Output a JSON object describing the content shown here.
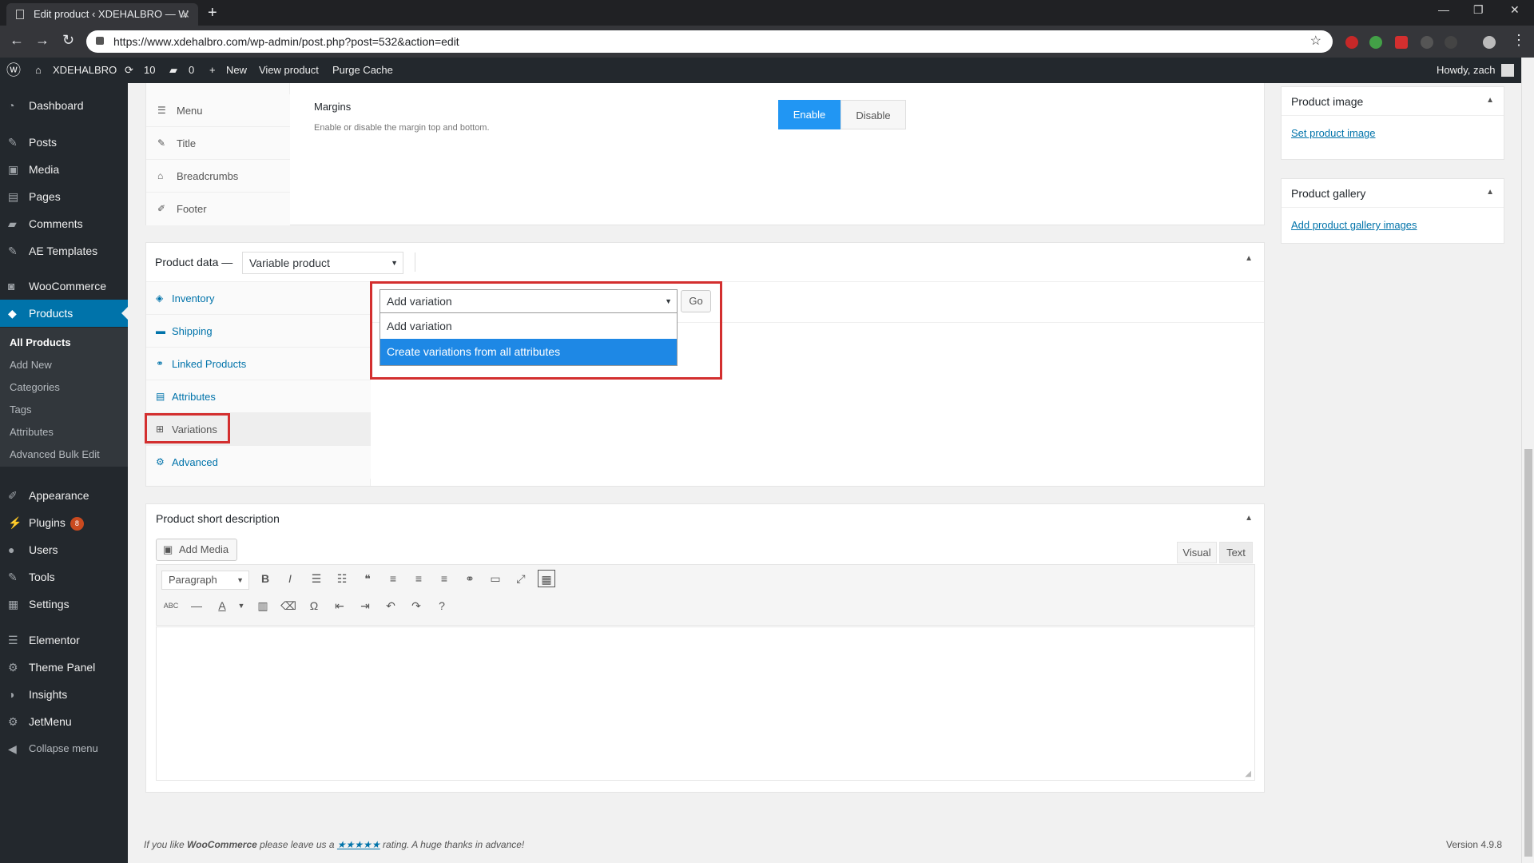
{
  "browser": {
    "tab_title": "Edit product ‹ XDEHALBRO — W",
    "url": "https://www.xdehalbro.com/wp-admin/post.php?post=532&action=edit"
  },
  "adminbar": {
    "site_name": "XDEHALBRO",
    "updates_count": "10",
    "comments_count": "0",
    "new_label": "New",
    "view_product": "View product",
    "purge_cache": "Purge Cache",
    "howdy": "Howdy, zach"
  },
  "sidebar": {
    "items": [
      {
        "label": "Dashboard",
        "icon": "dashboard-icon"
      },
      {
        "label": "Posts",
        "icon": "pin-icon"
      },
      {
        "label": "Media",
        "icon": "media-icon"
      },
      {
        "label": "Pages",
        "icon": "pages-icon"
      },
      {
        "label": "Comments",
        "icon": "comment-icon"
      },
      {
        "label": "AE Templates",
        "icon": "pin-icon"
      },
      {
        "label": "WooCommerce",
        "icon": "woo-icon"
      },
      {
        "label": "Products",
        "icon": "box-icon"
      },
      {
        "label": "Appearance",
        "icon": "brush-icon"
      },
      {
        "label": "Plugins",
        "icon": "plug-icon",
        "badge": "8"
      },
      {
        "label": "Users",
        "icon": "user-icon"
      },
      {
        "label": "Tools",
        "icon": "wrench-icon"
      },
      {
        "label": "Settings",
        "icon": "settings-icon"
      },
      {
        "label": "Elementor",
        "icon": "elementor-icon"
      },
      {
        "label": "Theme Panel",
        "icon": "gear-icon"
      },
      {
        "label": "Insights",
        "icon": "insights-icon"
      },
      {
        "label": "JetMenu",
        "icon": "gear-icon"
      },
      {
        "label": "Collapse menu",
        "icon": "collapse-icon"
      }
    ],
    "submenu": [
      "All Products",
      "Add New",
      "Categories",
      "Tags",
      "Attributes",
      "Advanced Bulk Edit"
    ]
  },
  "theme_panel": {
    "tabs": [
      "Menu",
      "Title",
      "Breadcrumbs",
      "Footer"
    ],
    "margins_title": "Margins",
    "margins_desc": "Enable or disable the margin top and bottom.",
    "enable_label": "Enable",
    "disable_label": "Disable"
  },
  "product_data": {
    "label": "Product data —",
    "type_selected": "Variable product",
    "tabs": [
      "Inventory",
      "Shipping",
      "Linked Products",
      "Attributes",
      "Variations",
      "Advanced"
    ],
    "variation_select": "Add variation",
    "go_label": "Go",
    "options": [
      "Add variation",
      "Create variations from all attributes"
    ]
  },
  "short_desc": {
    "title": "Product short description",
    "add_media": "Add Media",
    "visual_tab": "Visual",
    "text_tab": "Text",
    "format_select": "Paragraph"
  },
  "product_image": {
    "title": "Product image",
    "link": "Set product image"
  },
  "product_gallery": {
    "title": "Product gallery",
    "link": "Add product gallery images"
  },
  "footer": {
    "text_pre": "If you like ",
    "brand": "WooCommerce",
    "text_mid": " please leave us a ",
    "stars": "★★★★★",
    "text_post": " rating. A huge thanks in advance!",
    "version": "Version 4.9.8"
  },
  "colors": {
    "accent": "#0073aa",
    "admin_dark": "#23282d",
    "highlight_box": "#d32f2f",
    "dropdown_selected": "#1e88e5"
  }
}
